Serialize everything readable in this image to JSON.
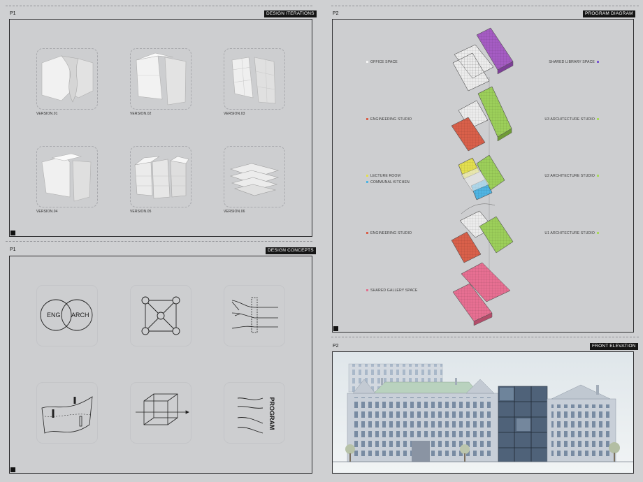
{
  "panels": {
    "iterations": {
      "tag": "P1",
      "title": "DESIGN ITERATIONS",
      "versions": [
        "VERSION.01",
        "VERSION.02",
        "VERSION.03",
        "VERSION.04",
        "VERSION.05",
        "VERSION.06"
      ]
    },
    "concepts": {
      "tag": "P1",
      "title": "DESIGN CONCEPTS",
      "venn_left": "ENG",
      "venn_right": "ARCH",
      "program_word": "PROGRAM"
    },
    "program": {
      "tag": "P2",
      "title": "PROGRAM DIAGRAM",
      "left_labels": [
        {
          "text": "OFFICE SPACE",
          "color": "#f4f4f4"
        },
        {
          "text": "ENGINEERING STUDIO",
          "color": "#d9604a"
        },
        {
          "text": "LECTURE ROOM",
          "color": "#e3df4f"
        },
        {
          "text": "COMMUNAL KITCHEN",
          "color": "#4fb4e2"
        },
        {
          "text": "ENGINEERING STUDIO",
          "color": "#d9604a"
        },
        {
          "text": "SHARED GALLERY SPACE",
          "color": "#e3708e"
        }
      ],
      "right_labels": [
        {
          "text": "SHARED LIBRARY SPACE",
          "color": "#7a57d1"
        },
        {
          "text": "U3 ARCHITECTURE STUDIO",
          "color": "#a8d95c"
        },
        {
          "text": "U2 ARCHITECTURE STUDIO",
          "color": "#a8d95c"
        },
        {
          "text": "U1 ARCHITECTURE STUDIO",
          "color": "#a8d95c"
        }
      ]
    },
    "elevation": {
      "tag": "P2",
      "title": "FRONT ELEVATION"
    }
  },
  "colors": {
    "office": "#ececec",
    "engineering": "#d9604a",
    "lecture": "#e3df4f",
    "kitchen": "#4fb4e2",
    "library": "#a55cc3",
    "architecture": "#9ccf5a",
    "gallery": "#e76f92",
    "panel_title_bg": "#151515"
  }
}
